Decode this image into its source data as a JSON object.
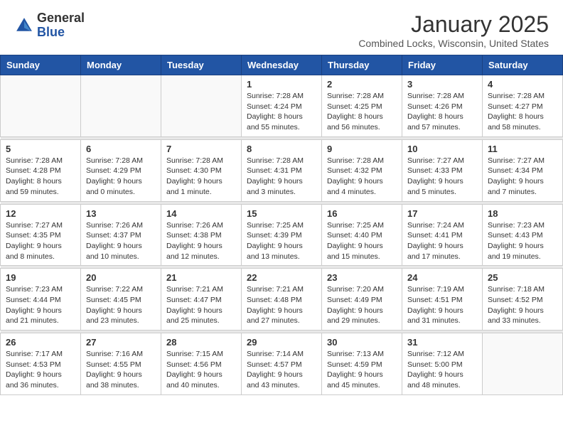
{
  "header": {
    "logo_general": "General",
    "logo_blue": "Blue",
    "month_title": "January 2025",
    "subtitle": "Combined Locks, Wisconsin, United States"
  },
  "days_of_week": [
    "Sunday",
    "Monday",
    "Tuesday",
    "Wednesday",
    "Thursday",
    "Friday",
    "Saturday"
  ],
  "weeks": [
    [
      {
        "day": "",
        "info": ""
      },
      {
        "day": "",
        "info": ""
      },
      {
        "day": "",
        "info": ""
      },
      {
        "day": "1",
        "info": "Sunrise: 7:28 AM\nSunset: 4:24 PM\nDaylight: 8 hours\nand 55 minutes."
      },
      {
        "day": "2",
        "info": "Sunrise: 7:28 AM\nSunset: 4:25 PM\nDaylight: 8 hours\nand 56 minutes."
      },
      {
        "day": "3",
        "info": "Sunrise: 7:28 AM\nSunset: 4:26 PM\nDaylight: 8 hours\nand 57 minutes."
      },
      {
        "day": "4",
        "info": "Sunrise: 7:28 AM\nSunset: 4:27 PM\nDaylight: 8 hours\nand 58 minutes."
      }
    ],
    [
      {
        "day": "5",
        "info": "Sunrise: 7:28 AM\nSunset: 4:28 PM\nDaylight: 8 hours\nand 59 minutes."
      },
      {
        "day": "6",
        "info": "Sunrise: 7:28 AM\nSunset: 4:29 PM\nDaylight: 9 hours\nand 0 minutes."
      },
      {
        "day": "7",
        "info": "Sunrise: 7:28 AM\nSunset: 4:30 PM\nDaylight: 9 hours\nand 1 minute."
      },
      {
        "day": "8",
        "info": "Sunrise: 7:28 AM\nSunset: 4:31 PM\nDaylight: 9 hours\nand 3 minutes."
      },
      {
        "day": "9",
        "info": "Sunrise: 7:28 AM\nSunset: 4:32 PM\nDaylight: 9 hours\nand 4 minutes."
      },
      {
        "day": "10",
        "info": "Sunrise: 7:27 AM\nSunset: 4:33 PM\nDaylight: 9 hours\nand 5 minutes."
      },
      {
        "day": "11",
        "info": "Sunrise: 7:27 AM\nSunset: 4:34 PM\nDaylight: 9 hours\nand 7 minutes."
      }
    ],
    [
      {
        "day": "12",
        "info": "Sunrise: 7:27 AM\nSunset: 4:35 PM\nDaylight: 9 hours\nand 8 minutes."
      },
      {
        "day": "13",
        "info": "Sunrise: 7:26 AM\nSunset: 4:37 PM\nDaylight: 9 hours\nand 10 minutes."
      },
      {
        "day": "14",
        "info": "Sunrise: 7:26 AM\nSunset: 4:38 PM\nDaylight: 9 hours\nand 12 minutes."
      },
      {
        "day": "15",
        "info": "Sunrise: 7:25 AM\nSunset: 4:39 PM\nDaylight: 9 hours\nand 13 minutes."
      },
      {
        "day": "16",
        "info": "Sunrise: 7:25 AM\nSunset: 4:40 PM\nDaylight: 9 hours\nand 15 minutes."
      },
      {
        "day": "17",
        "info": "Sunrise: 7:24 AM\nSunset: 4:41 PM\nDaylight: 9 hours\nand 17 minutes."
      },
      {
        "day": "18",
        "info": "Sunrise: 7:23 AM\nSunset: 4:43 PM\nDaylight: 9 hours\nand 19 minutes."
      }
    ],
    [
      {
        "day": "19",
        "info": "Sunrise: 7:23 AM\nSunset: 4:44 PM\nDaylight: 9 hours\nand 21 minutes."
      },
      {
        "day": "20",
        "info": "Sunrise: 7:22 AM\nSunset: 4:45 PM\nDaylight: 9 hours\nand 23 minutes."
      },
      {
        "day": "21",
        "info": "Sunrise: 7:21 AM\nSunset: 4:47 PM\nDaylight: 9 hours\nand 25 minutes."
      },
      {
        "day": "22",
        "info": "Sunrise: 7:21 AM\nSunset: 4:48 PM\nDaylight: 9 hours\nand 27 minutes."
      },
      {
        "day": "23",
        "info": "Sunrise: 7:20 AM\nSunset: 4:49 PM\nDaylight: 9 hours\nand 29 minutes."
      },
      {
        "day": "24",
        "info": "Sunrise: 7:19 AM\nSunset: 4:51 PM\nDaylight: 9 hours\nand 31 minutes."
      },
      {
        "day": "25",
        "info": "Sunrise: 7:18 AM\nSunset: 4:52 PM\nDaylight: 9 hours\nand 33 minutes."
      }
    ],
    [
      {
        "day": "26",
        "info": "Sunrise: 7:17 AM\nSunset: 4:53 PM\nDaylight: 9 hours\nand 36 minutes."
      },
      {
        "day": "27",
        "info": "Sunrise: 7:16 AM\nSunset: 4:55 PM\nDaylight: 9 hours\nand 38 minutes."
      },
      {
        "day": "28",
        "info": "Sunrise: 7:15 AM\nSunset: 4:56 PM\nDaylight: 9 hours\nand 40 minutes."
      },
      {
        "day": "29",
        "info": "Sunrise: 7:14 AM\nSunset: 4:57 PM\nDaylight: 9 hours\nand 43 minutes."
      },
      {
        "day": "30",
        "info": "Sunrise: 7:13 AM\nSunset: 4:59 PM\nDaylight: 9 hours\nand 45 minutes."
      },
      {
        "day": "31",
        "info": "Sunrise: 7:12 AM\nSunset: 5:00 PM\nDaylight: 9 hours\nand 48 minutes."
      },
      {
        "day": "",
        "info": ""
      }
    ]
  ]
}
